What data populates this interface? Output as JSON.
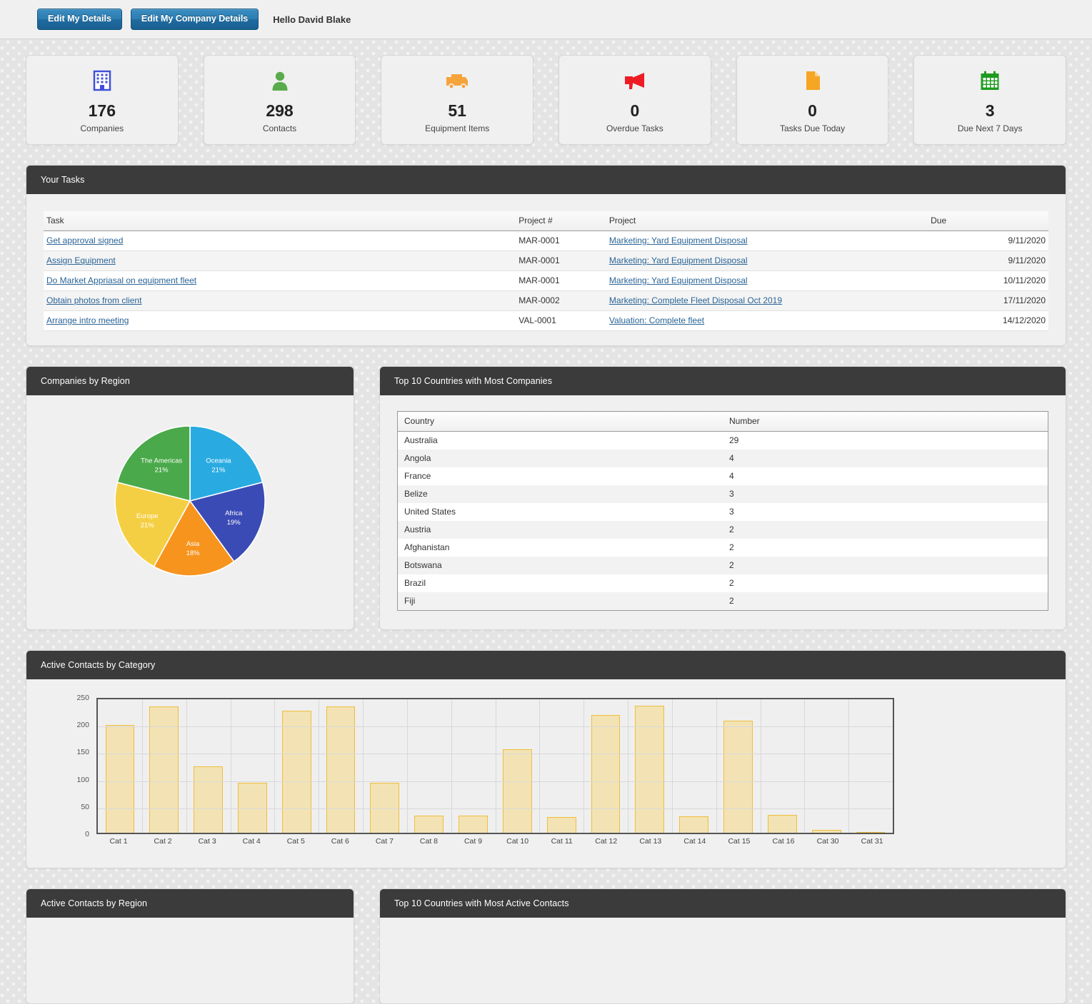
{
  "topbar": {
    "edit_details_label": "Edit My Details",
    "edit_company_label": "Edit My Company Details",
    "greeting": "Hello David Blake"
  },
  "stats": [
    {
      "icon": "building-icon",
      "color": "#3f51d9",
      "value": "176",
      "label": "Companies"
    },
    {
      "icon": "person-icon",
      "color": "#5aab4c",
      "value": "298",
      "label": "Contacts"
    },
    {
      "icon": "truck-icon",
      "color": "#f5a43c",
      "value": "51",
      "label": "Equipment Items"
    },
    {
      "icon": "megaphone-icon",
      "color": "#ed1c24",
      "value": "0",
      "label": "Overdue Tasks"
    },
    {
      "icon": "document-icon",
      "color": "#f5a623",
      "value": "0",
      "label": "Tasks Due Today"
    },
    {
      "icon": "calendar-icon",
      "color": "#1f9b1f",
      "value": "3",
      "label": "Due Next 7 Days"
    }
  ],
  "tasks_panel": {
    "title": "Your Tasks",
    "columns": [
      "Task",
      "Project #",
      "Project",
      "Due"
    ],
    "rows": [
      {
        "task": "Get approval signed",
        "project_no": "MAR-0001",
        "project": "Marketing: Yard Equipment Disposal",
        "due": "9/11/2020"
      },
      {
        "task": "Assign Equipment",
        "project_no": "MAR-0001",
        "project": "Marketing: Yard Equipment Disposal",
        "due": "9/11/2020"
      },
      {
        "task": "Do Market Appriasal on equipment fleet",
        "project_no": "MAR-0001",
        "project": "Marketing: Yard Equipment Disposal",
        "due": "10/11/2020"
      },
      {
        "task": "Obtain photos from client",
        "project_no": "MAR-0002",
        "project": "Marketing: Complete Fleet Disposal Oct 2019",
        "due": "17/11/2020"
      },
      {
        "task": "Arrange intro meeting",
        "project_no": "VAL-0001",
        "project": "Valuation: Complete fleet",
        "due": "14/12/2020"
      }
    ]
  },
  "pie_panel": {
    "title": "Companies by Region"
  },
  "countries_panel": {
    "title": "Top 10 Countries with Most Companies",
    "columns": [
      "Country",
      "Number"
    ],
    "rows": [
      {
        "country": "Australia",
        "number": "29"
      },
      {
        "country": "Angola",
        "number": "4"
      },
      {
        "country": "France",
        "number": "4"
      },
      {
        "country": "Belize",
        "number": "3"
      },
      {
        "country": "United States",
        "number": "3"
      },
      {
        "country": "Austria",
        "number": "2"
      },
      {
        "country": "Afghanistan",
        "number": "2"
      },
      {
        "country": "Botswana",
        "number": "2"
      },
      {
        "country": "Brazil",
        "number": "2"
      },
      {
        "country": "Fiji",
        "number": "2"
      }
    ]
  },
  "bar_panel": {
    "title": "Active Contacts by Category"
  },
  "bottom_panels": {
    "left_title": "Active Contacts by Region",
    "right_title": "Top 10 Countries with Most Active Contacts"
  },
  "chart_data": [
    {
      "type": "pie",
      "title": "Companies by Region",
      "labels": [
        "Oceania",
        "Africa",
        "Asia",
        "Europe",
        "The Americas"
      ],
      "values": [
        21,
        19,
        18,
        21,
        21
      ],
      "value_labels": [
        "21%",
        "19%",
        "18%",
        "21%",
        "21%"
      ],
      "colors": [
        "#29abe2",
        "#3b4bb5",
        "#f7941e",
        "#f5cf43",
        "#4aa94a"
      ],
      "start_angle_deg": 0,
      "direction": "clockwise",
      "legend": "none"
    },
    {
      "type": "bar",
      "title": "Active Contacts by Category",
      "categories": [
        "Cat 1",
        "Cat 2",
        "Cat 3",
        "Cat 4",
        "Cat 5",
        "Cat 6",
        "Cat 7",
        "Cat 8",
        "Cat 9",
        "Cat 10",
        "Cat 11",
        "Cat 12",
        "Cat 13",
        "Cat 14",
        "Cat 15",
        "Cat 16",
        "Cat 30",
        "Cat 31"
      ],
      "values": [
        202,
        236,
        125,
        93,
        228,
        236,
        93,
        32,
        32,
        157,
        29,
        221,
        238,
        31,
        210,
        33,
        6,
        1
      ],
      "xlabel": "",
      "ylabel": "",
      "ylim": [
        0,
        250
      ],
      "yticks": [
        0,
        50,
        100,
        150,
        200,
        250
      ],
      "grid": true,
      "bar_fill": "#f3e3b4",
      "bar_border": "#eebe3c"
    }
  ]
}
